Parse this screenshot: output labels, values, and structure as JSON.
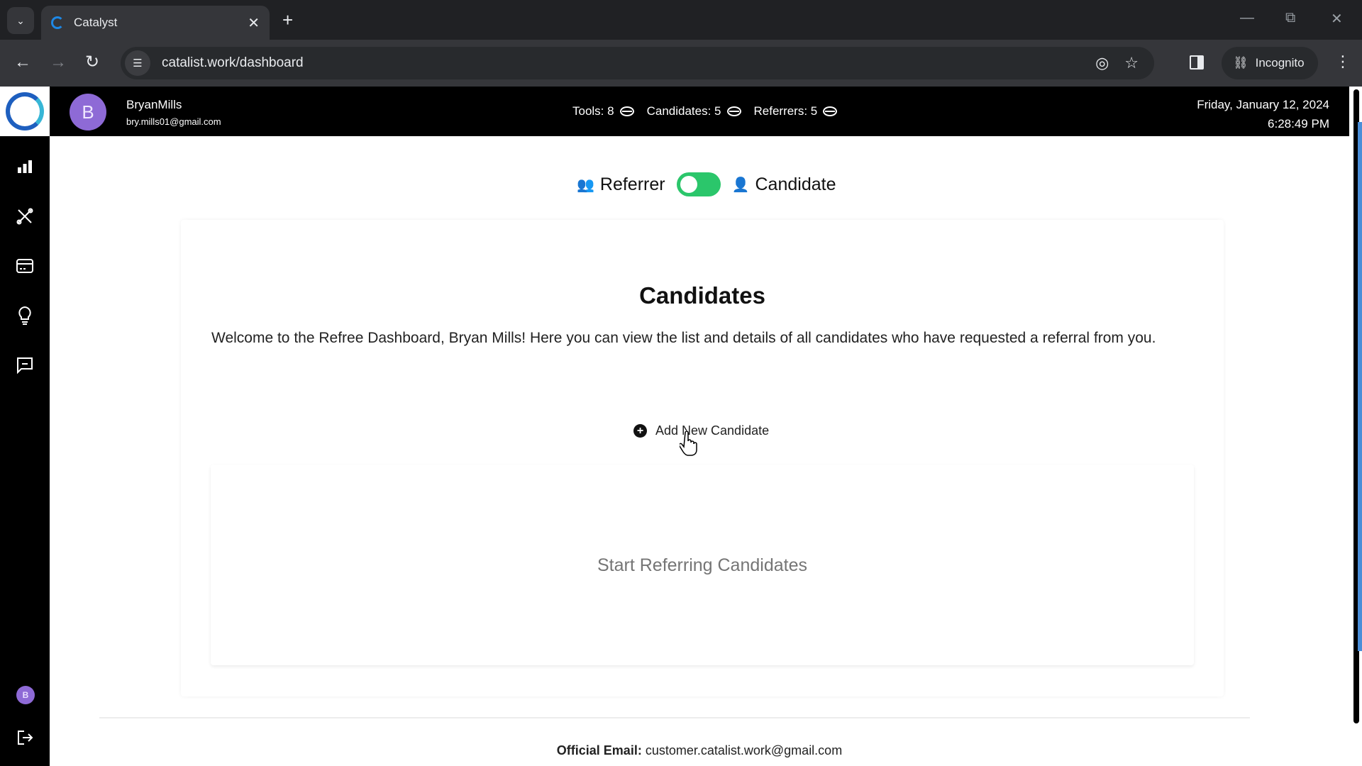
{
  "browser": {
    "tab_title": "Catalyst",
    "url": "catalist.work/dashboard",
    "incognito_label": "Incognito"
  },
  "sidebar": {
    "items": [
      {
        "icon": "bar-chart-icon",
        "label": "Dashboard"
      },
      {
        "icon": "tools-icon",
        "label": "Tools"
      },
      {
        "icon": "card-icon",
        "label": "Payments"
      },
      {
        "icon": "lightbulb-icon",
        "label": "Ideas"
      },
      {
        "icon": "message-icon",
        "label": "Messages"
      }
    ],
    "avatar_initial": "B"
  },
  "header": {
    "avatar_initial": "B",
    "user_name": "BryanMills",
    "user_email": "bry.mills01@gmail.com",
    "stats": [
      {
        "label": "Tools: 8"
      },
      {
        "label": "Candidates: 5"
      },
      {
        "label": "Referrers: 5"
      }
    ],
    "date": "Friday, January 12, 2024",
    "time": "6:28:49 PM"
  },
  "mode_toggle": {
    "left_label": "Referrer",
    "right_label": "Candidate",
    "state": "on",
    "accent_color": "#2bc66b"
  },
  "main": {
    "title": "Candidates",
    "welcome_text": "Welcome to the Refree Dashboard, Bryan Mills! Here you can view the list and details of all candidates who have requested a referral from you.",
    "add_button_label": "Add New Candidate",
    "empty_state": "Start Referring Candidates"
  },
  "footer": {
    "email_label": "Official Email:",
    "email_value": "customer.catalist.work@gmail.com"
  }
}
